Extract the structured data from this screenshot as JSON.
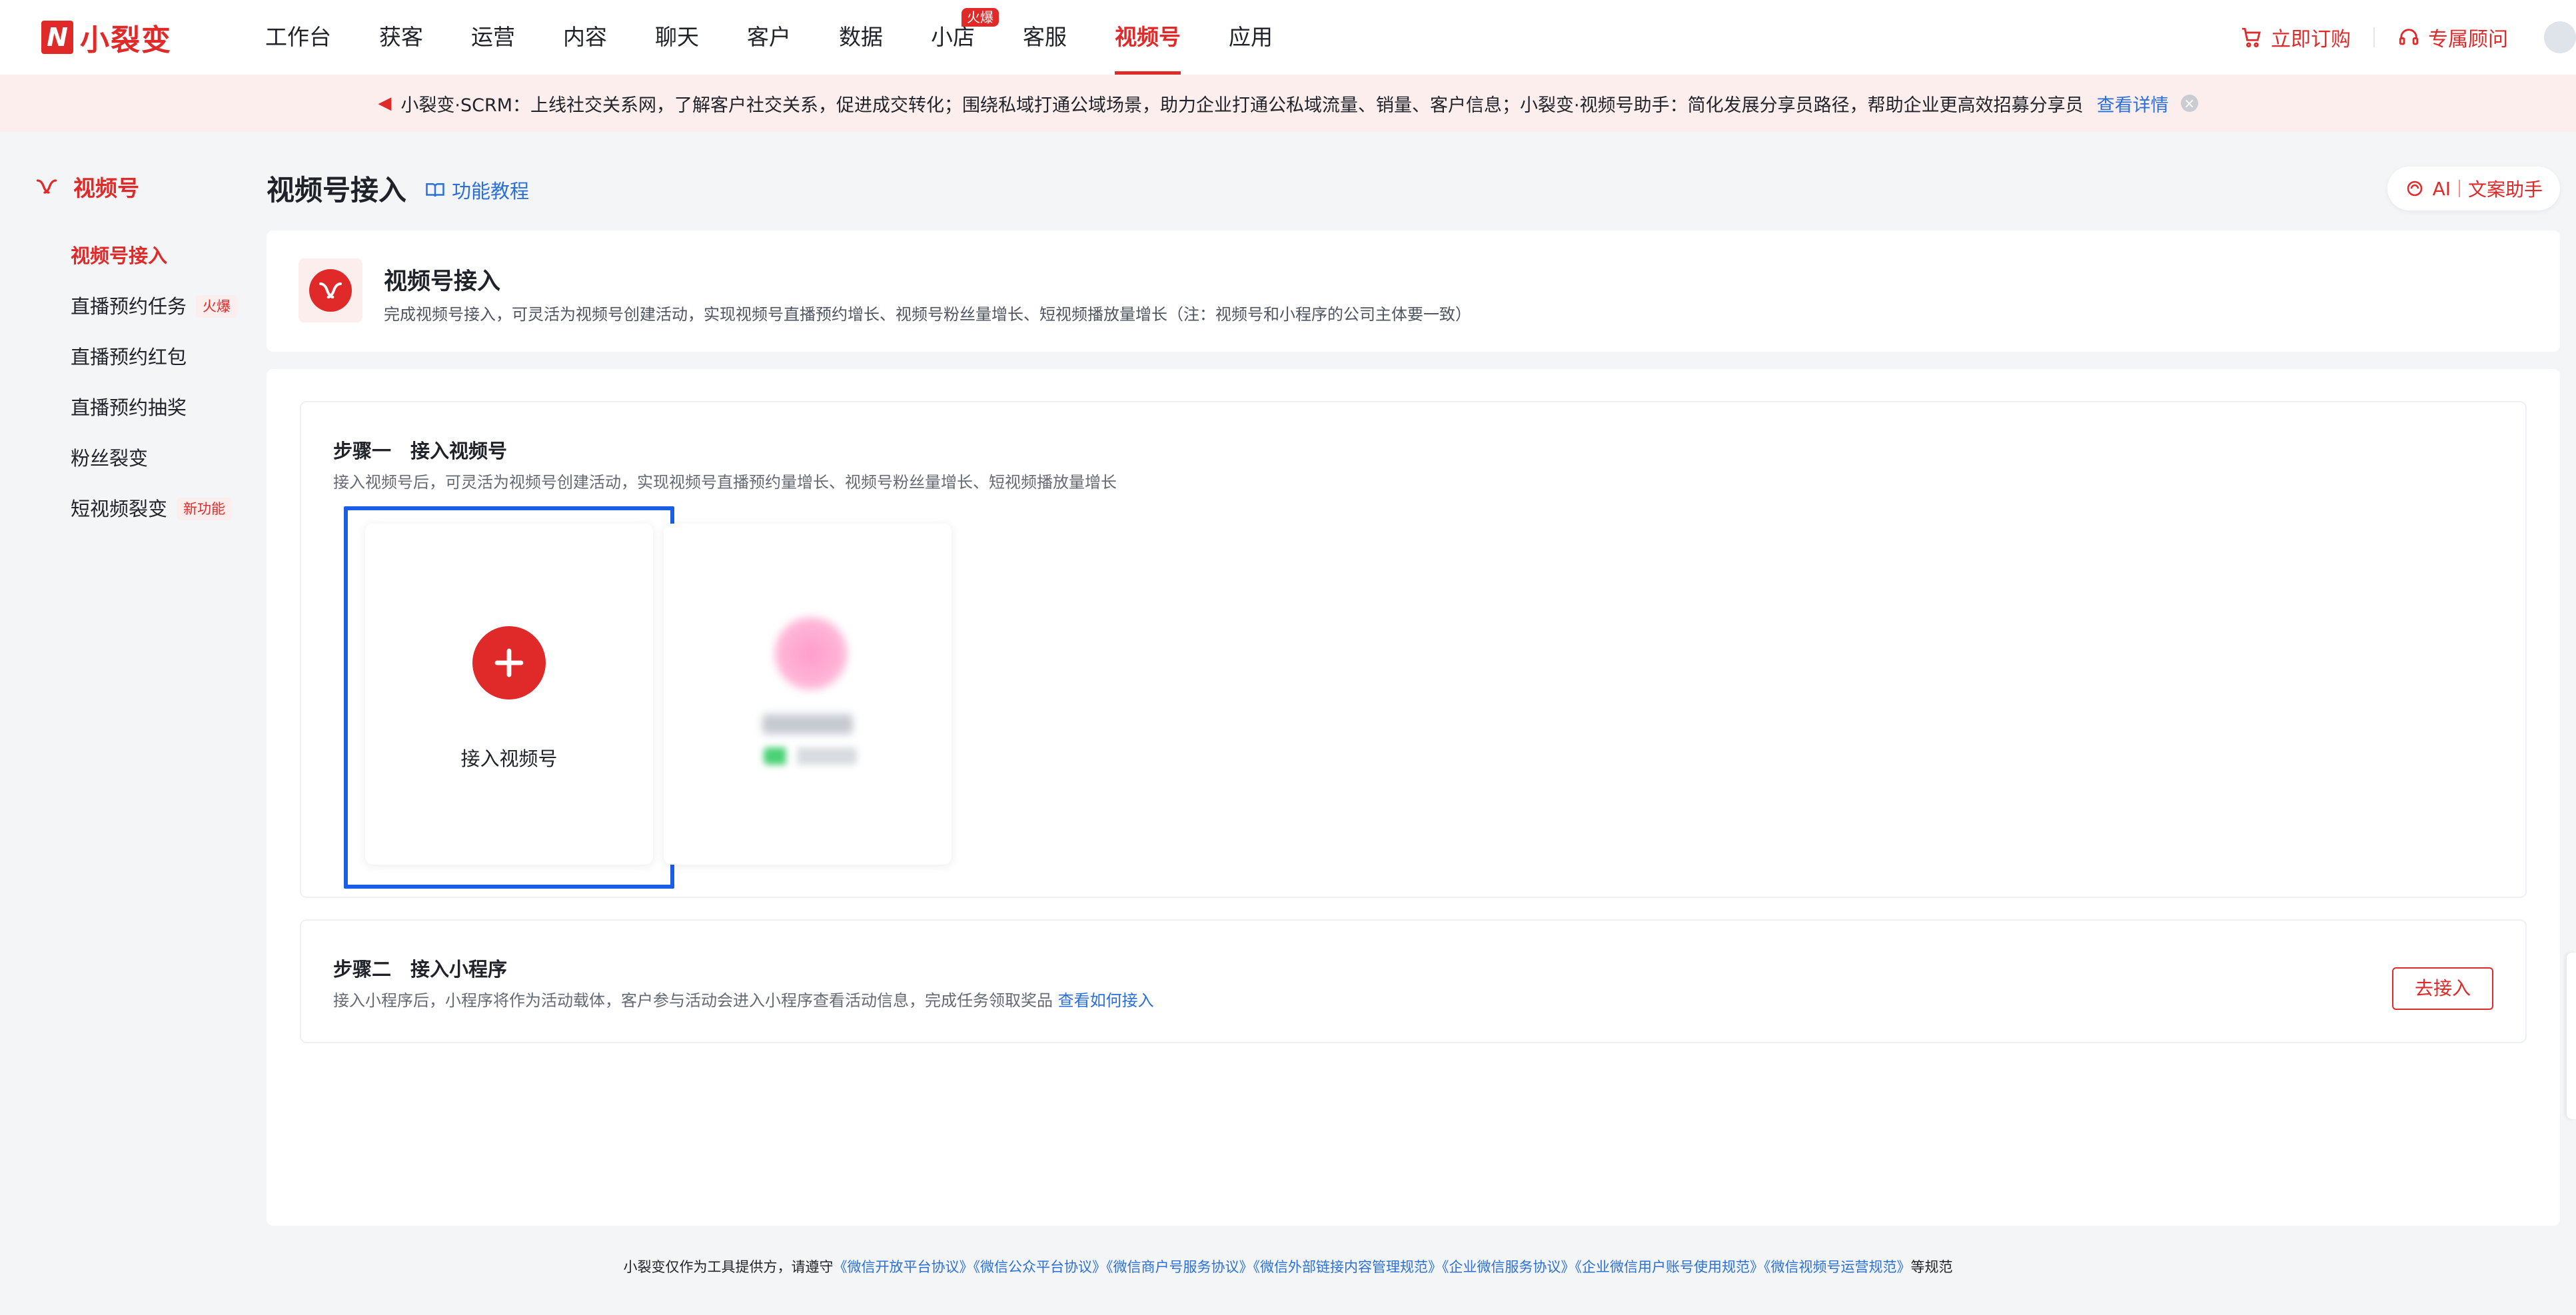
{
  "app": {
    "logo_text": "小裂变",
    "logo_mark": "N"
  },
  "nav": {
    "items": [
      {
        "label": "工作台"
      },
      {
        "label": "获客"
      },
      {
        "label": "运营"
      },
      {
        "label": "内容"
      },
      {
        "label": "聊天"
      },
      {
        "label": "客户"
      },
      {
        "label": "数据"
      },
      {
        "label": "小店",
        "badge": "火爆"
      },
      {
        "label": "客服"
      },
      {
        "label": "视频号"
      },
      {
        "label": "应用"
      }
    ],
    "active_index": 9,
    "right": {
      "order": "立即订购",
      "advisor": "专属顾问"
    }
  },
  "notice": {
    "text": "小裂变·SCRM：上线社交关系网，了解客户社交关系，促进成交转化；围绕私域打通公域场景，助力企业打通公私域流量、销量、客户信息；小裂变·视频号助手：简化发展分享员路径，帮助企业更高效招募分享员",
    "link": "查看详情",
    "close_icon": "×"
  },
  "sidebar": {
    "header": "视频号",
    "items": [
      {
        "label": "视频号接入",
        "tag": ""
      },
      {
        "label": "直播预约任务",
        "tag": "火爆"
      },
      {
        "label": "直播预约红包",
        "tag": ""
      },
      {
        "label": "直播预约抽奖",
        "tag": ""
      },
      {
        "label": "粉丝裂变",
        "tag": ""
      },
      {
        "label": "短视频裂变",
        "tag": "新功能"
      }
    ],
    "active_index": 0
  },
  "page": {
    "title": "视频号接入",
    "tutorial": "功能教程",
    "ai_label": "AI",
    "ai_assistant": "文案助手"
  },
  "intro": {
    "title": "视频号接入",
    "desc": "完成视频号接入，可灵活为视频号创建活动，实现视频号直播预约增长、视频号粉丝量增长、短视频播放量增长（注：视频号和小程序的公司主体要一致）"
  },
  "step1": {
    "title": "步骤一　接入视频号",
    "desc": "接入视频号后，可灵活为视频号创建活动，实现视频号直播预约量增长、视频号粉丝量增长、短视频播放量增长",
    "add_label": "接入视频号"
  },
  "step2": {
    "title": "步骤二　接入小程序",
    "desc": "接入小程序后，小程序将作为活动载体，客户参与活动会进入小程序查看活动信息，完成任务领取奖品",
    "link": "查看如何接入",
    "button": "去接入"
  },
  "footer": {
    "prefix": "小裂变仅作为工具提供方，请遵守",
    "links": [
      "《微信开放平台协议》",
      "《微信公众平台协议》",
      "《微信商户号服务协议》",
      "《微信外部链接内容管理规范》",
      "《企业微信服务协议》",
      "《企业微信用户账号使用规范》",
      "《微信视频号运营规范》"
    ],
    "suffix": "等规范"
  },
  "colors": {
    "brand": "#e02a2a",
    "link": "#2a6fdb",
    "highlight": "#1a5ee8"
  }
}
